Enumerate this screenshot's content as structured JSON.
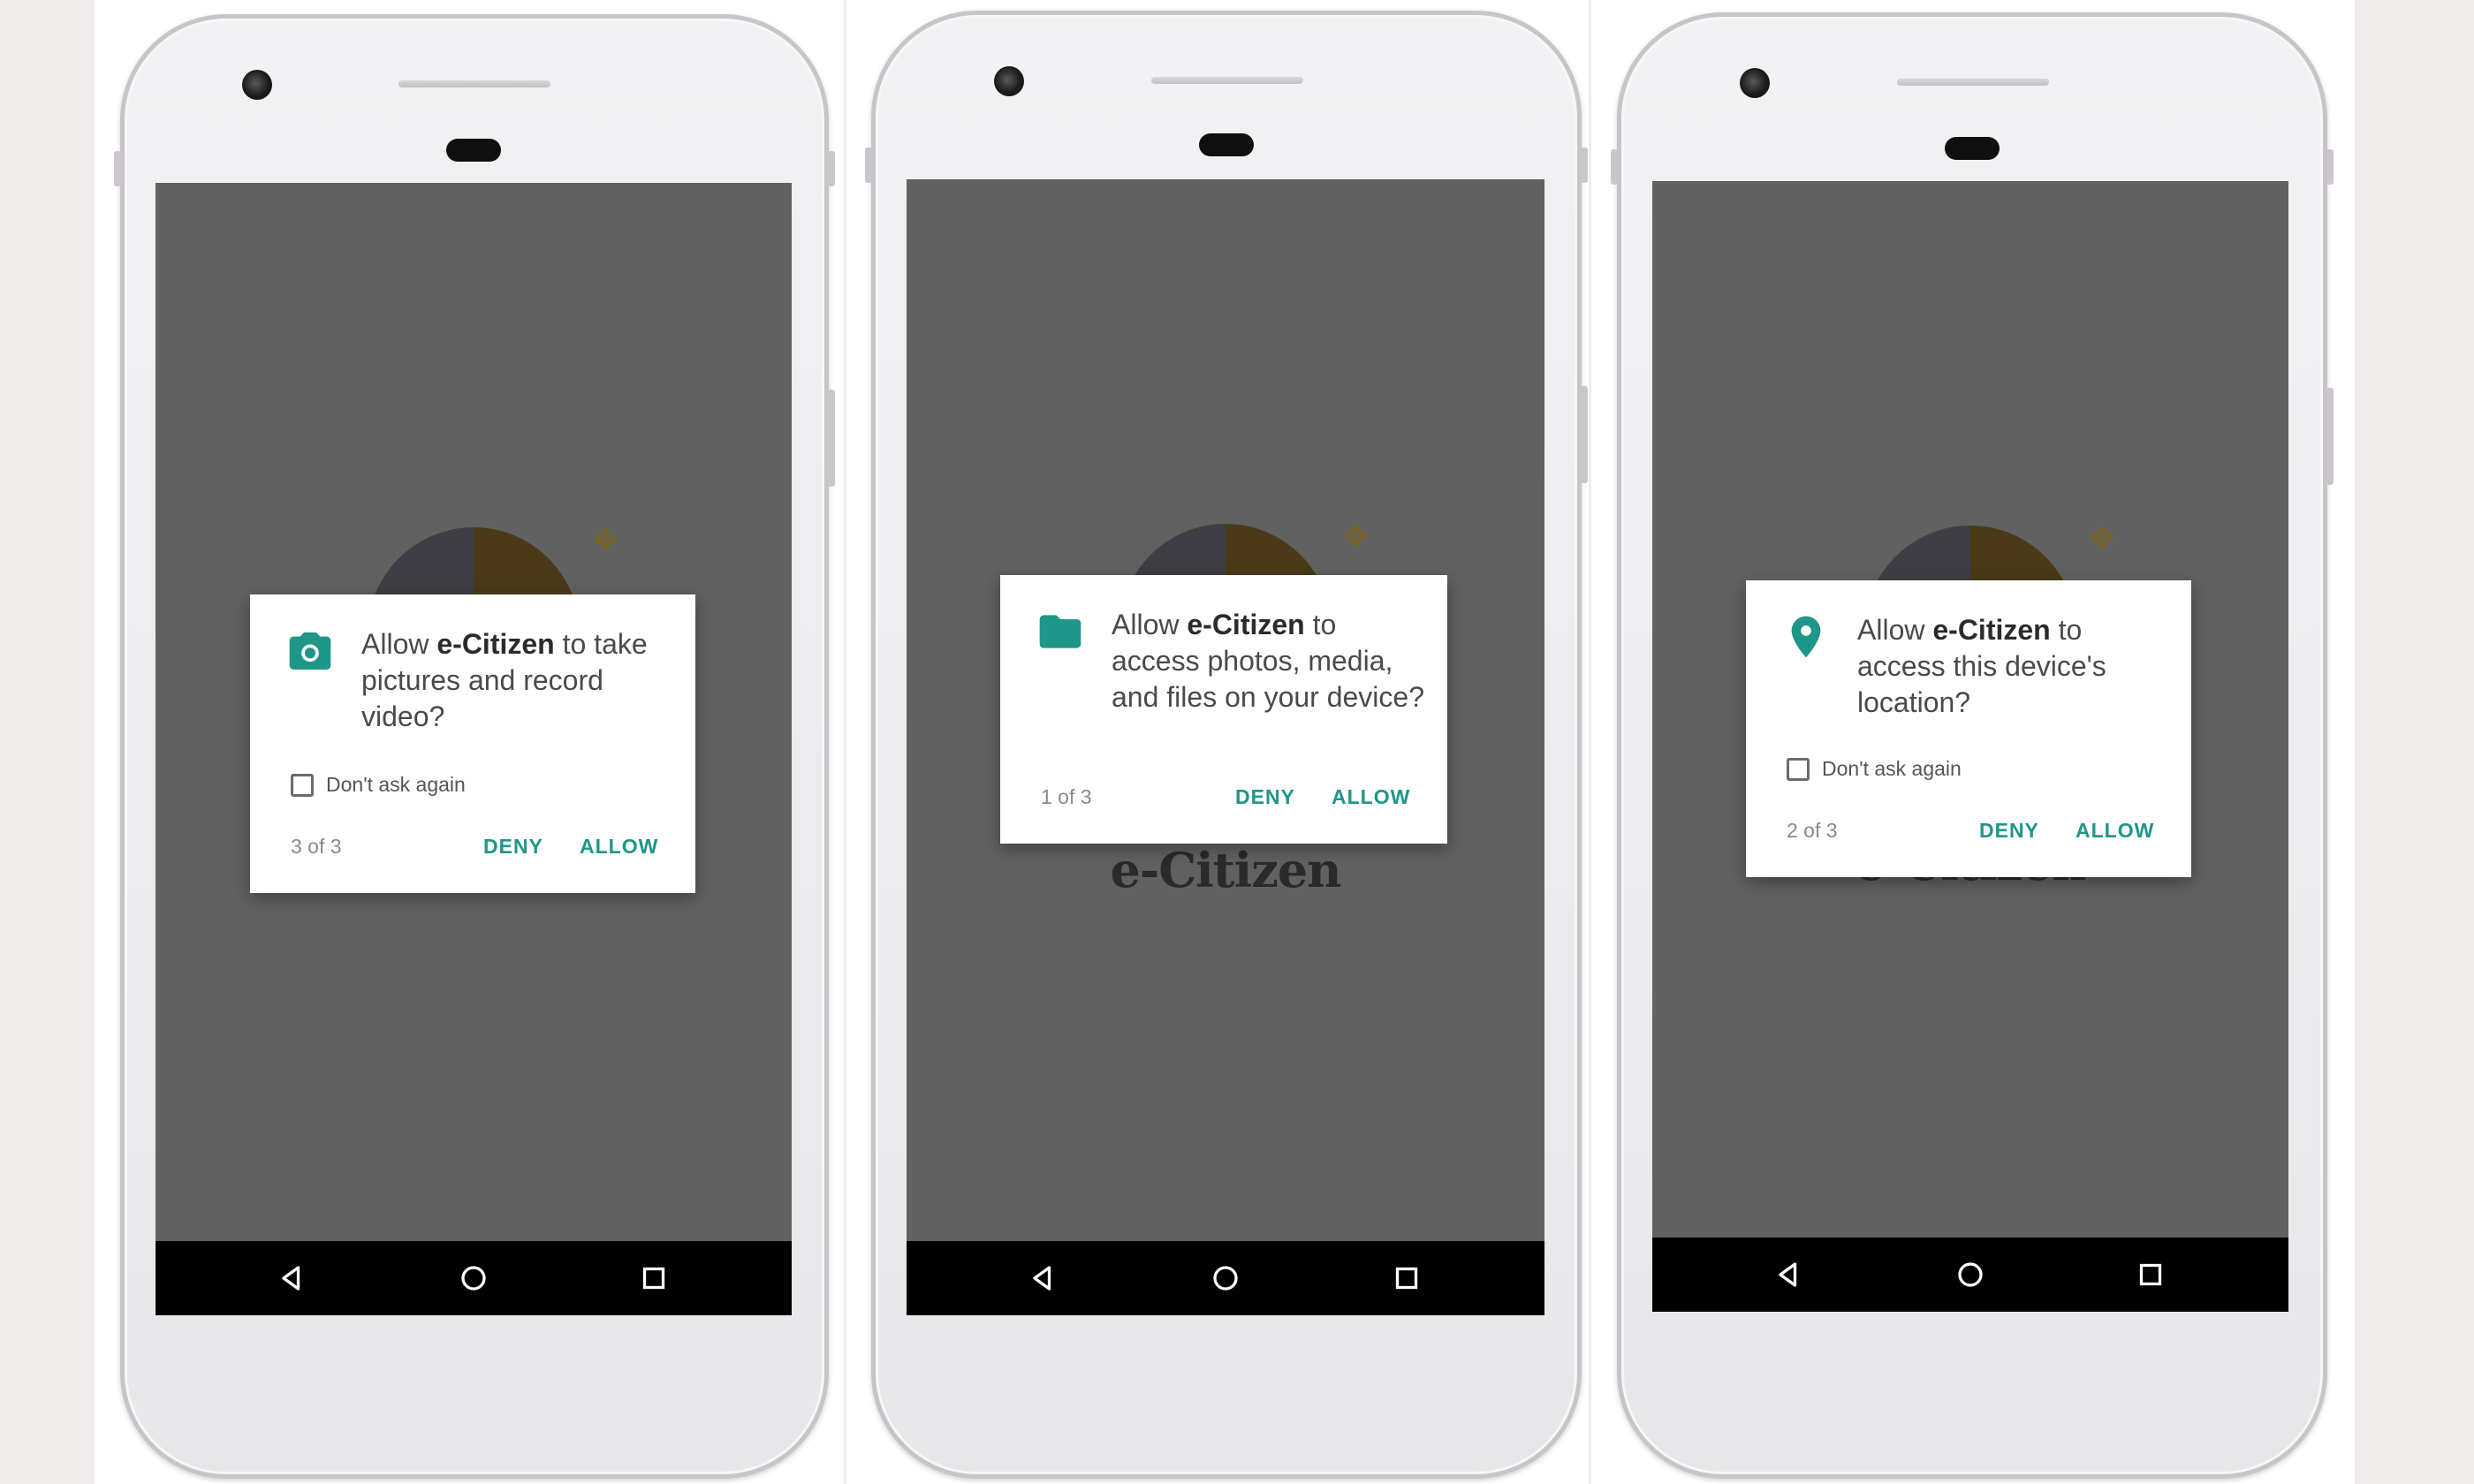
{
  "brand": {
    "accent": "#1e9688",
    "logo_text": "e-Citizen"
  },
  "phones": [
    {
      "dialog": {
        "icon": "camera-icon",
        "msg_prefix": "Allow ",
        "app_name": "e-Citizen",
        "msg_suffix": " to take pictures and record video?",
        "dont_ask_label": "Don't ask again",
        "counter": "3 of 3",
        "deny_label": "DENY",
        "allow_label": "ALLOW"
      }
    },
    {
      "dialog": {
        "icon": "folder-icon",
        "msg_prefix": "Allow ",
        "app_name": "e-Citizen",
        "msg_suffix": " to access photos, media, and files on your device?",
        "counter": "1 of 3",
        "deny_label": "DENY",
        "allow_label": "ALLOW"
      }
    },
    {
      "dialog": {
        "icon": "location-pin-icon",
        "msg_prefix": "Allow ",
        "app_name": "e-Citizen",
        "msg_suffix": " to access this device's location?",
        "dont_ask_label": "Don't ask again",
        "counter": "2 of 3",
        "deny_label": "DENY",
        "allow_label": "ALLOW"
      }
    }
  ]
}
